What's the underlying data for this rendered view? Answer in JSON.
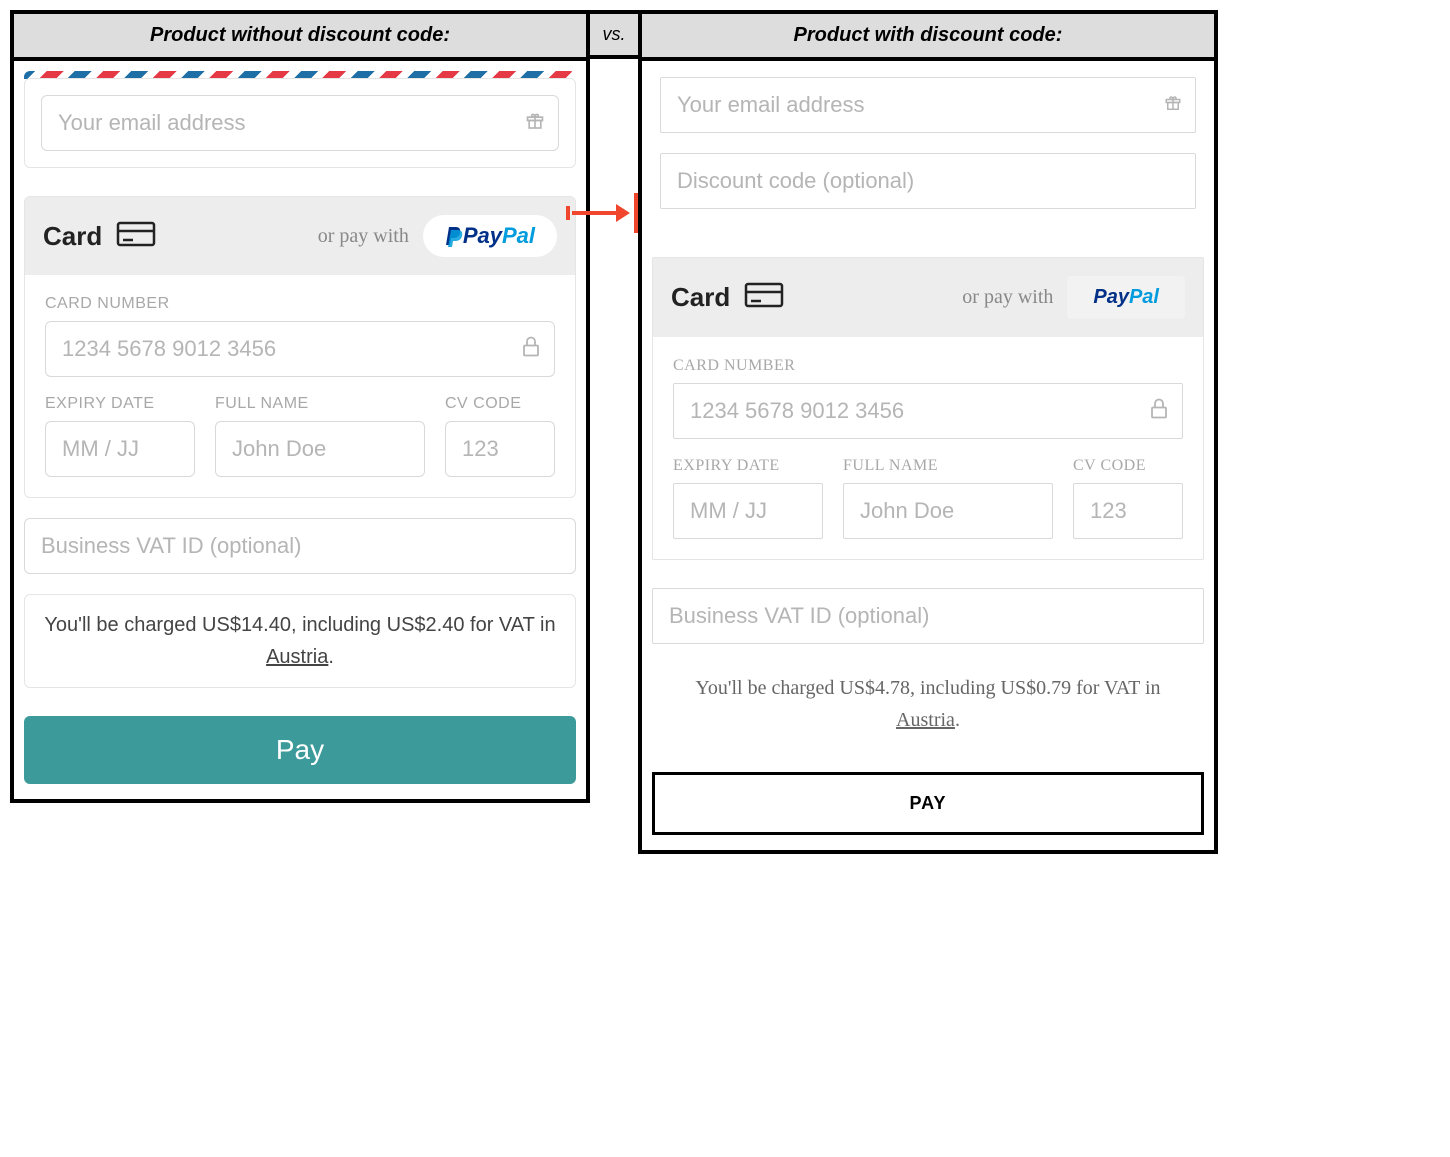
{
  "left": {
    "title": "Product without discount code:",
    "email_placeholder": "Your email address",
    "card_label": "Card",
    "or_pay_with": "or pay with",
    "paypal_text1": "Pay",
    "paypal_text2": "Pal",
    "card_number_label": "CARD NUMBER",
    "card_number_placeholder": "1234 5678 9012 3456",
    "expiry_label": "EXPIRY DATE",
    "expiry_placeholder": "MM / JJ",
    "fullname_label": "FULL NAME",
    "fullname_placeholder": "John Doe",
    "cv_label": "CV CODE",
    "cv_placeholder": "123",
    "vat_placeholder": "Business VAT ID (optional)",
    "charge_prefix": "You'll be charged ",
    "charge_total": "US$14.40",
    "charge_mid": ", including ",
    "charge_vat": "US$2.40",
    "charge_for": " for VAT in ",
    "charge_country": "Austria",
    "pay_label": "Pay"
  },
  "vs": "vs.",
  "right": {
    "title": "Product with discount code:",
    "email_placeholder": "Your email address",
    "discount_placeholder": "Discount code (optional)",
    "card_label": "Card",
    "or_pay_with": "or pay with",
    "paypal_text1": "Pay",
    "paypal_text2": "Pal",
    "card_number_label": "CARD NUMBER",
    "card_number_placeholder": "1234 5678 9012 3456",
    "expiry_label": "EXPIRY DATE",
    "expiry_placeholder": "MM / JJ",
    "fullname_label": "FULL NAME",
    "fullname_placeholder": "John Doe",
    "cv_label": "CV CODE",
    "cv_placeholder": "123",
    "vat_placeholder": "Business VAT ID (optional)",
    "charge_prefix": "You'll be charged ",
    "charge_total": "US$4.78",
    "charge_mid": ", including ",
    "charge_vat": "US$0.79",
    "charge_for": " for VAT in ",
    "charge_country": "Austria",
    "pay_label": "PAY"
  }
}
